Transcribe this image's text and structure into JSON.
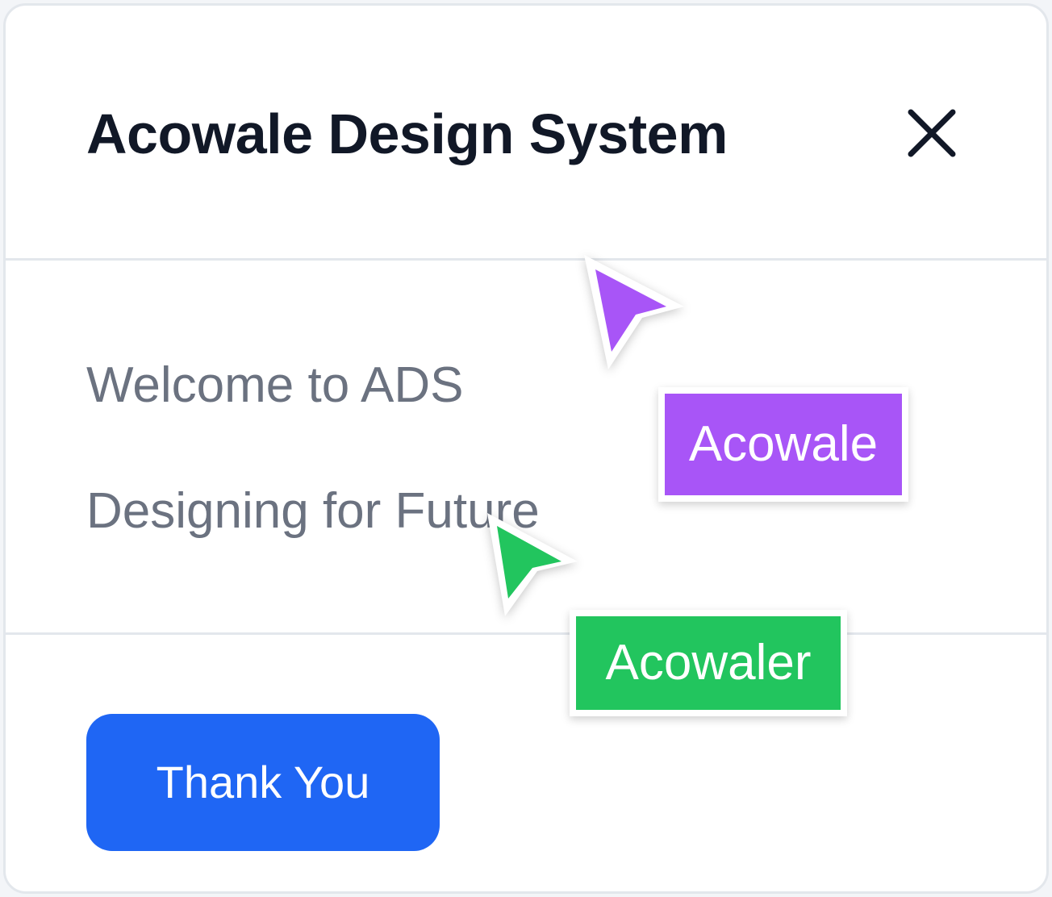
{
  "dialog": {
    "title": "Acowale Design System",
    "close_icon": "close-icon",
    "body": {
      "line1": "Welcome to ADS",
      "line2": "Designing for Future"
    },
    "button_label": "Thank You"
  },
  "collaborators": [
    {
      "name": "Acowale",
      "color": "#a855f7",
      "icon": "cursor-arrow-icon"
    },
    {
      "name": "Acowaler",
      "color": "#22c55e",
      "icon": "cursor-arrow-icon"
    }
  ],
  "colors": {
    "title": "#111827",
    "body_text": "#6b7280",
    "primary_button": "#1f66f4",
    "divider": "#e3e7ec"
  }
}
